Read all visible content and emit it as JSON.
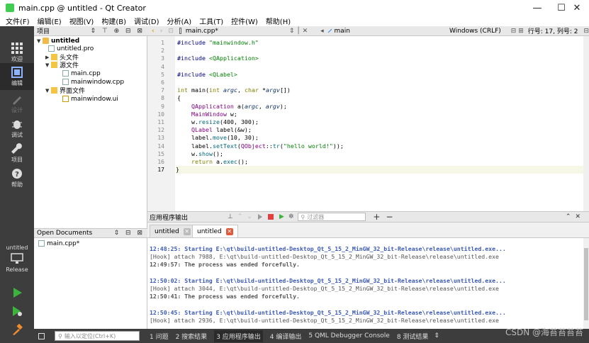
{
  "window": {
    "title": "main.cpp @ untitled - Qt Creator",
    "minimize": "—",
    "maximize": "☐",
    "close": "✕"
  },
  "menu": [
    "文件(F)",
    "编辑(E)",
    "视图(V)",
    "构建(B)",
    "调试(D)",
    "分析(A)",
    "工具(T)",
    "控件(W)",
    "帮助(H)"
  ],
  "modes": {
    "welcome": "欢迎",
    "edit": "编辑",
    "design": "设计",
    "debug": "调试",
    "projects": "项目",
    "help": "帮助"
  },
  "kit": {
    "project": "untitled",
    "build": "Release"
  },
  "project_pane": {
    "title": "项目",
    "tree": [
      {
        "label": "untitled",
        "bold": true
      },
      {
        "label": "untitled.pro"
      },
      {
        "label": "头文件"
      },
      {
        "label": "源文件"
      },
      {
        "label": "main.cpp"
      },
      {
        "label": "mainwindow.cpp"
      },
      {
        "label": "界面文件"
      },
      {
        "label": "mainwindow.ui"
      }
    ]
  },
  "open_documents": {
    "title": "Open Documents",
    "items": [
      "main.cpp*"
    ]
  },
  "editor_toolbar": {
    "file": "main.cpp*",
    "symbol": "main",
    "encoding": "Windows (CRLF)",
    "position": "行号: 17, 列号: 2"
  },
  "editor": {
    "current_line": 17,
    "lines": [
      "#include \"mainwindow.h\"",
      "",
      "#include <QApplication>",
      "",
      "#include <QLabel>",
      "",
      "int main(int argc, char *argv[])",
      "{",
      "    QApplication a(argc, argv);",
      "    MainWindow w;",
      "    w.resize(400, 300);",
      "    QLabel label(&w);",
      "    label.move(10, 30);",
      "    label.setText(QObject::tr(\"hello world!\"));",
      "    w.show();",
      "    return a.exec();",
      "}"
    ]
  },
  "output_pane": {
    "title": "应用程序输出",
    "filter_placeholder": "过滤器",
    "tabs": [
      "untitled",
      "untitled"
    ],
    "lines": [
      {
        "kind": "start",
        "text": "12:48:25: Starting E:\\qt\\build-untitled-Desktop_Qt_5_15_2_MinGW_32_bit-Release\\release\\untitled.exe..."
      },
      {
        "kind": "hook",
        "text": "[Hook] attach 7988, E:\\qt\\build-untitled-Desktop_Qt_5_15_2_MinGW_32_bit-Release\\release\\untitled.exe"
      },
      {
        "kind": "end",
        "text": "12:49:57: The process was ended forcefully."
      },
      {
        "kind": "blank",
        "text": ""
      },
      {
        "kind": "start",
        "text": "12:50:02: Starting E:\\qt\\build-untitled-Desktop_Qt_5_15_2_MinGW_32_bit-Release\\release\\untitled.exe..."
      },
      {
        "kind": "hook",
        "text": "[Hook] attach 3044, E:\\qt\\build-untitled-Desktop_Qt_5_15_2_MinGW_32_bit-Release\\release\\untitled.exe"
      },
      {
        "kind": "end",
        "text": "12:50:41: The process was ended forcefully."
      },
      {
        "kind": "blank",
        "text": ""
      },
      {
        "kind": "start",
        "text": "12:50:45: Starting E:\\qt\\build-untitled-Desktop_Qt_5_15_2_MinGW_32_bit-Release\\release\\untitled.exe..."
      },
      {
        "kind": "hook",
        "text": "[Hook] attach 2936, E:\\qt\\build-untitled-Desktop_Qt_5_15_2_MinGW_32_bit-Release\\release\\untitled.exe"
      }
    ]
  },
  "statusbar": {
    "locator_placeholder": "输入以定位(Ctrl+K)",
    "panes": [
      "1 问题",
      "2 搜索结果",
      "3 应用程序输出",
      "4 编译输出",
      "5 QML Debugger Console",
      "8 测试结果"
    ],
    "active_pane": 2
  },
  "watermark": "CSDN @海苔苔苔苔",
  "colors": {
    "modebar": "#3d3d3d",
    "close_tab_red": "#e05a3a",
    "run_green": "#3cb33c",
    "output_start": "#3b59b8"
  }
}
